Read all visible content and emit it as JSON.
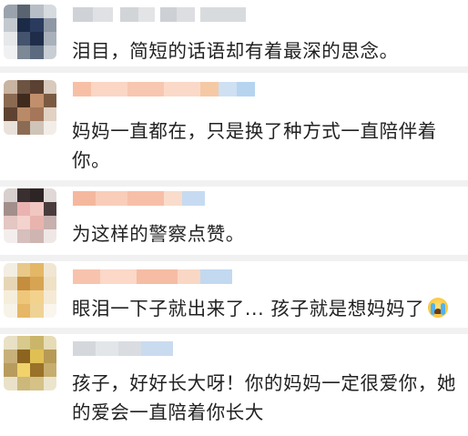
{
  "comments": [
    {
      "text": "泪目，简短的话语却有着最深的思念。",
      "emoji": ""
    },
    {
      "text": "妈妈一直都在，只是换了种方式一直陪伴着你。",
      "emoji": ""
    },
    {
      "text": "为这样的警察点赞。",
      "emoji": ""
    },
    {
      "text": "眼泪一下子就出来了... 孩子就是想妈妈了",
      "emoji": "crying-face"
    },
    {
      "text": "孩子，好好长大呀！你的妈妈一定很爱你，她的爱会一直陪着你长大",
      "emoji": ""
    }
  ],
  "colors": {
    "separator": "#f1f1f1",
    "text": "#222222"
  }
}
